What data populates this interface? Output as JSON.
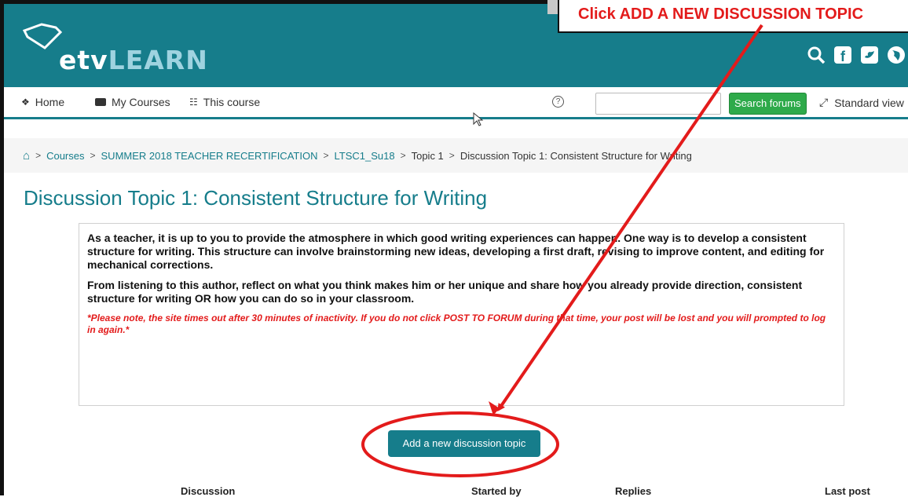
{
  "header": {
    "logo_text_a": "etv",
    "logo_text_b": "LEARN",
    "social_icons": [
      "search-icon",
      "facebook-icon",
      "twitter-icon",
      "globe-icon"
    ],
    "brand_color": "#167d8b"
  },
  "nav": {
    "home": "Home",
    "my_courses": "My Courses",
    "this_course": "This course",
    "search_placeholder": "",
    "search_button": "Search forums",
    "standard_view": "Standard view"
  },
  "breadcrumb": [
    "Courses",
    "SUMMER 2018 TEACHER RECERTIFICATION",
    "LTSC1_Su18",
    "Topic 1",
    "Discussion Topic 1: Consistent Structure for Writing"
  ],
  "page": {
    "title": "Discussion Topic 1: Consistent Structure for Writing",
    "intro_p1": "As a teacher, it is up to you to provide the atmosphere in which good writing experiences can happen. One way is to develop a consistent structure for writing. This structure can involve brainstorming new ideas, developing a first draft, revising to improve content, and editing for mechanical corrections.",
    "intro_p2": "From listening to this author, reflect on what you think makes him or her unique and share how you already provide direction, consistent structure for writing OR how you can do so in your classroom.",
    "note": "*Please note, the site times out after 30 minutes of inactivity. If you do not click POST TO FORUM during that time, your post will be lost and you will prompted to log in again.*",
    "add_button": "Add a new discussion topic"
  },
  "table": {
    "columns": [
      "Discussion",
      "Started by",
      "Replies",
      "Last post"
    ]
  },
  "annotation": {
    "callout_text": "Click ADD A NEW DISCUSSION TOPIC",
    "color": "#e31b1b"
  }
}
